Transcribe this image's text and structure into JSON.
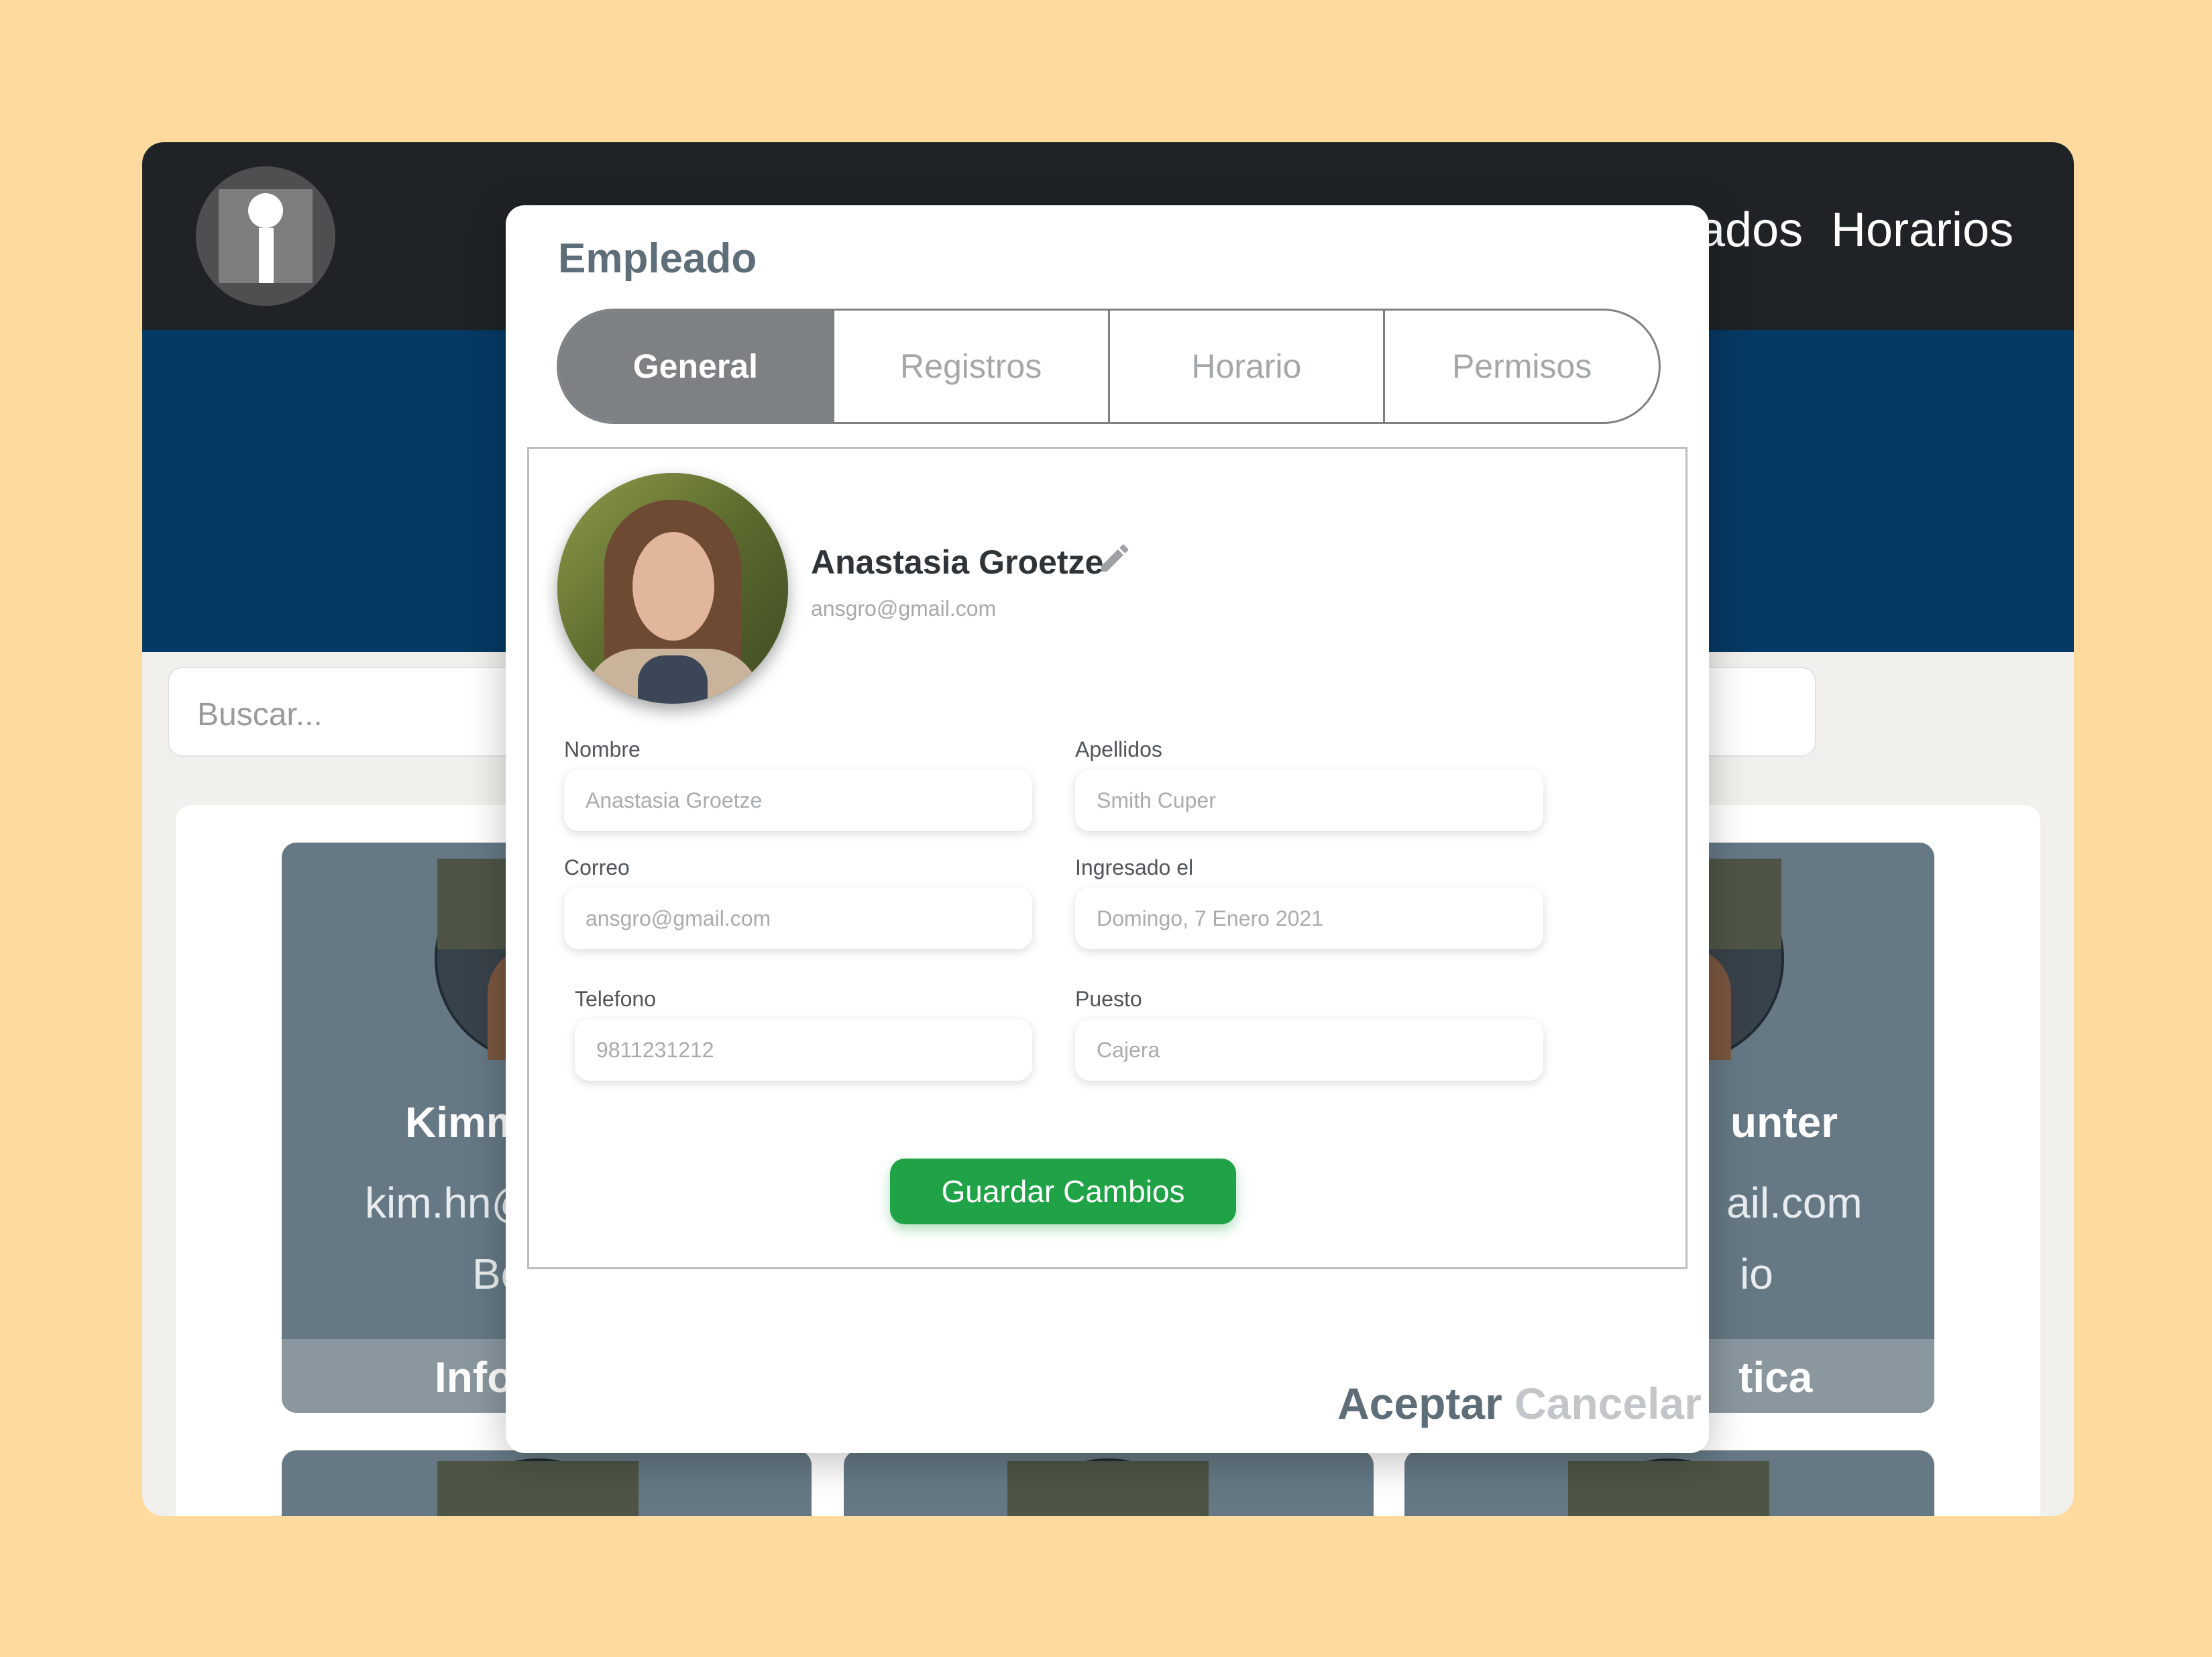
{
  "nav": {
    "item_employees_partial": "ados",
    "item_schedules": "Horarios"
  },
  "search": {
    "placeholder": "Buscar..."
  },
  "cards": {
    "left": {
      "name": "Kimm",
      "email": "kim.hn@",
      "role": "Bo",
      "footer": "Info"
    },
    "right": {
      "name": "unter",
      "email": "ail.com",
      "role": "io",
      "footer": "tica"
    }
  },
  "modal": {
    "title": "Empleado",
    "tabs": [
      "General",
      "Registros",
      "Horario",
      "Permisos"
    ],
    "profile": {
      "name": "Anastasia Groetze",
      "email": "ansgro@gmail.com"
    },
    "fields": {
      "nombre": {
        "label": "Nombre",
        "value": "Anastasia Groetze"
      },
      "apellidos": {
        "label": "Apellidos",
        "value": "Smith Cuper"
      },
      "correo": {
        "label": "Correo",
        "value": "ansgro@gmail.com"
      },
      "ingresado": {
        "label": "Ingresado el",
        "value": "Domingo, 7 Enero 2021"
      },
      "telefono": {
        "label": "Telefono",
        "value": "9811231212"
      },
      "puesto": {
        "label": "Puesto",
        "value": "Cajera"
      }
    },
    "save_label": "Guardar Cambios",
    "accept_label": "Aceptar",
    "cancel_label": "Cancelar"
  },
  "colors": {
    "page_bg": "#FEDA9E",
    "topbar": "#1F2326",
    "banner": "#063963",
    "card": "#657884",
    "tab_active": "#7E8183",
    "save_button": "#1FA346",
    "accept_text": "#5E6E78",
    "cancel_text": "#C3C6C8"
  },
  "icons": [
    "fingerprint-logo-icon",
    "pencil-edit-icon"
  ]
}
